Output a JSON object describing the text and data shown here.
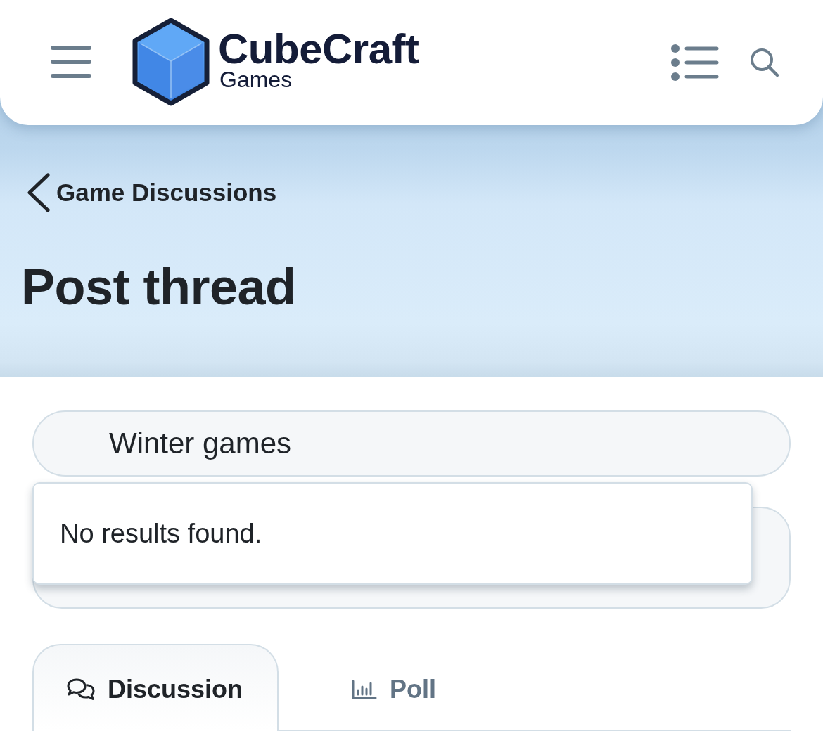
{
  "header": {
    "brand": "CubeCraft",
    "brand_sub": "Games"
  },
  "breadcrumb": {
    "label": "Game Discussions"
  },
  "page_title": "Post thread",
  "tag_field": {
    "value": "Winter games"
  },
  "suggestions": {
    "message": "No results found."
  },
  "tabs": [
    {
      "label": "Discussion",
      "kind": "discussion",
      "selected": true
    },
    {
      "label": "Poll",
      "kind": "poll",
      "selected": false
    }
  ]
}
